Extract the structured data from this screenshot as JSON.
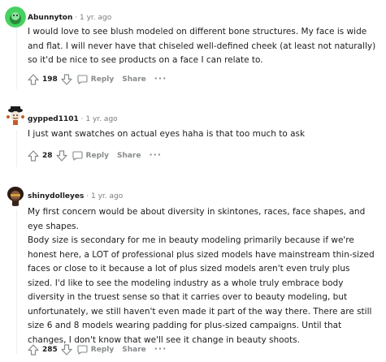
{
  "comments": [
    {
      "username": "Abunnyton",
      "time": "1 yr. ago",
      "paragraphs": [
        "I would love to see blush modeled on different bone structures. My face is wide and flat. I will never have that chiseled well-defined cheek (at least not naturally) so it'd be nice to see products on a face I can relate to."
      ],
      "score": "198",
      "reply_label": "Reply",
      "share_label": "Share",
      "more_label": "···",
      "avatar_color": "#46d160"
    },
    {
      "username": "gypped1101",
      "time": "1 yr. ago",
      "paragraphs": [
        "I just want swatches on actual eyes haha is that too much to ask"
      ],
      "score": "28",
      "reply_label": "Reply",
      "share_label": "Share",
      "more_label": "···",
      "avatar_color": "#ffffff"
    },
    {
      "username": "shinydolleyes",
      "time": "1 yr. ago",
      "paragraphs": [
        "My first concern would be about diversity in skintones, races, face shapes, and eye shapes.",
        "Body size is secondary for me in beauty modeling primarily because if we're honest here, a LOT of professional plus sized models have mainstream thin-sized faces or close to it because a lot of plus sized models aren't even truly plus sized. I'd like to see the modeling industry as a whole truly embrace body diversity in the truest sense so that it carries over to beauty modeling, but unfortunately, we still haven't even made it part of the way there. There are still size 6 and 8 models wearing padding for plus-sized campaigns. Until that changes, I don't know that we'll see it change in beauty shoots."
      ],
      "score": "285",
      "reply_label": "Reply",
      "share_label": "Share",
      "more_label": "···",
      "avatar_color": "#2b1b12"
    }
  ],
  "meta_separator": "·"
}
